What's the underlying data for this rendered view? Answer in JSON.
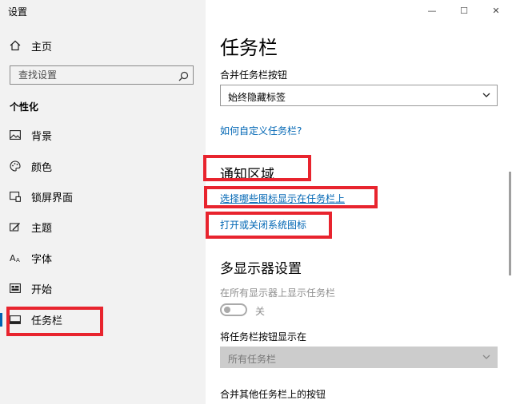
{
  "window": {
    "title": "设置",
    "controls": {
      "minimize": "—",
      "maximize": "☐",
      "close": "✕"
    }
  },
  "sidebar": {
    "home": {
      "label": "主页",
      "icon": "home-icon"
    },
    "search": {
      "placeholder": "查找设置",
      "icon": "search-icon"
    },
    "section_title": "个性化",
    "items": [
      {
        "label": "背景",
        "icon": "picture-icon"
      },
      {
        "label": "颜色",
        "icon": "palette-icon"
      },
      {
        "label": "锁屏界面",
        "icon": "lockscreen-icon"
      },
      {
        "label": "主题",
        "icon": "theme-icon"
      },
      {
        "label": "字体",
        "icon": "font-icon"
      },
      {
        "label": "开始",
        "icon": "start-icon"
      },
      {
        "label": "任务栏",
        "icon": "taskbar-icon",
        "selected": true
      }
    ]
  },
  "main": {
    "title": "任务栏",
    "combine_buttons": {
      "label": "合并任务栏按钮",
      "value": "始终隐藏标签"
    },
    "customize_link": "如何自定义任务栏?",
    "notification_area": {
      "heading": "通知区域",
      "link_select_icons": "选择哪些图标显示在任务栏上",
      "link_system_icons": "打开或关闭系统图标"
    },
    "multi_display": {
      "heading": "多显示器设置",
      "show_on_all_label": "在所有显示器上显示任务栏",
      "show_on_all_state": "关",
      "show_buttons_label": "将任务栏按钮显示在",
      "show_buttons_value": "所有任务栏",
      "combine_other_label": "合并其他任务栏上的按钮"
    }
  },
  "colors": {
    "accent": "#0063b1",
    "link": "#0066b4",
    "highlight": "#e8242e",
    "sidebar_bg": "#f2f2f2"
  }
}
